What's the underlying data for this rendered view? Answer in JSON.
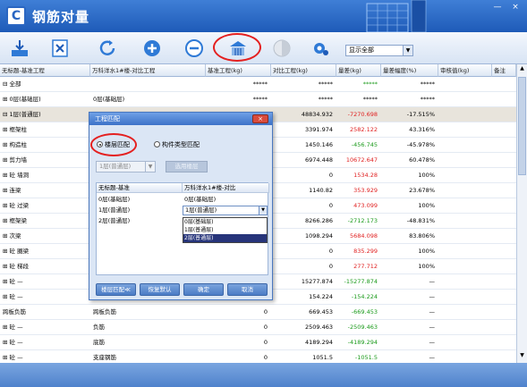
{
  "window": {
    "app_icon": "C",
    "title": "钢筋对量",
    "minimize": "—",
    "close": "×"
  },
  "toolbar": {
    "buttons": [
      "import-icon",
      "export-excel-icon",
      "refresh-icon",
      "expand-icon",
      "collapse-icon",
      "floor-match-icon",
      "compare-icon",
      "settings-icon"
    ],
    "display_select": "显示全部"
  },
  "grid": {
    "headers": [
      "无标题-基准工程",
      "万科洋水1#楼-对比工程",
      "基准工程(kg)",
      "对比工程(kg)",
      "量差(kg)",
      "量差幅度(%)",
      "审核值(kg)",
      "备注"
    ],
    "rows": [
      {
        "name": "⊟ 全部",
        "compare": "",
        "base": "*****",
        "cmp": "*****",
        "diff": "*****",
        "pct": "*****",
        "diff_color": "green"
      },
      {
        "name": "⊞ 0层(基础层)",
        "compare": "0层(基础层)",
        "base": "*****",
        "cmp": "*****",
        "diff": "*****",
        "pct": "*****",
        "diff_color": ""
      },
      {
        "name": "⊟ 1层(普通层)",
        "compare": "",
        "base": "",
        "cmp": "48834.932",
        "diff": "-7270.698",
        "pct": "-17.515%",
        "diff_color": "red"
      },
      {
        "name": "⊞ 框架柱",
        "compare": "",
        "base": "",
        "cmp": "3391.974",
        "diff": "2582.122",
        "pct": "43.316%",
        "diff_color": "red"
      },
      {
        "name": "⊞ 构造柱",
        "compare": "",
        "base": "",
        "cmp": "1450.146",
        "diff": "-456.745",
        "pct": "-45.978%",
        "diff_color": "green"
      },
      {
        "name": "⊞ 剪力墙",
        "compare": "",
        "base": "",
        "cmp": "6974.448",
        "diff": "10672.647",
        "pct": "60.478%",
        "diff_color": "red"
      },
      {
        "name": "⊞ 砼 墙洞",
        "compare": "",
        "base": "",
        "cmp": "0",
        "diff": "1534.28",
        "pct": "100%",
        "diff_color": "red"
      },
      {
        "name": "⊞ 连梁",
        "compare": "",
        "base": "",
        "cmp": "1140.82",
        "diff": "353.929",
        "pct": "23.678%",
        "diff_color": "red"
      },
      {
        "name": "⊞ 砼 过梁",
        "compare": "",
        "base": "",
        "cmp": "0",
        "diff": "473.099",
        "pct": "100%",
        "diff_color": "red"
      },
      {
        "name": "⊞ 框架梁",
        "compare": "",
        "base": "",
        "cmp": "8266.286",
        "diff": "-2712.173",
        "pct": "-48.831%",
        "diff_color": "green"
      },
      {
        "name": "⊞ 次梁",
        "compare": "",
        "base": "",
        "cmp": "1098.294",
        "diff": "5684.098",
        "pct": "83.806%",
        "diff_color": "red"
      },
      {
        "name": "⊞ 砼 圈梁",
        "compare": "",
        "base": "",
        "cmp": "0",
        "diff": "835.299",
        "pct": "100%",
        "diff_color": "red"
      },
      {
        "name": "⊞ 砼 梯段",
        "compare": "",
        "base": "",
        "cmp": "0",
        "diff": "277.712",
        "pct": "100%",
        "diff_color": "red"
      },
      {
        "name": "⊞ 砼 —",
        "compare": "",
        "base": "",
        "cmp": "15277.874",
        "diff": "-15277.874",
        "pct": "—",
        "diff_color": "green"
      },
      {
        "name": "⊞ 砼 —",
        "compare": "",
        "base": "",
        "cmp": "154.224",
        "diff": "-154.224",
        "pct": "—",
        "diff_color": "green"
      },
      {
        "name": "跨板负筋",
        "compare": "跨板负筋",
        "base": "0",
        "cmp": "669.453",
        "diff": "-669.453",
        "pct": "—",
        "diff_color": "green"
      },
      {
        "name": "⊞ 砼 —",
        "compare": "负筋",
        "base": "0",
        "cmp": "2509.463",
        "diff": "-2509.463",
        "pct": "—",
        "diff_color": "green"
      },
      {
        "name": "⊞ 砼 —",
        "compare": "底筋",
        "base": "0",
        "cmp": "4189.294",
        "diff": "-4189.294",
        "pct": "—",
        "diff_color": "green"
      },
      {
        "name": "⊞ 砼 —",
        "compare": "支座钢筋",
        "base": "0",
        "cmp": "1051.5",
        "diff": "-1051.5",
        "pct": "—",
        "diff_color": "green"
      }
    ]
  },
  "dialog": {
    "title": "工程匹配",
    "close": "×",
    "radio_floor": "楼层匹配",
    "radio_type": "构件类型匹配",
    "floor_select": "1层(普通层)",
    "apply_button": "选用楼层",
    "table_headers": [
      "无标题-基准",
      "万科洋水1#楼-对比"
    ],
    "table_rows": [
      {
        "left": "0层(基础层)",
        "right": "0层(基础层)"
      },
      {
        "left": "1层(普通层)",
        "right": "1层(普通层)"
      },
      {
        "left": "2层(普通层)",
        "right": ""
      }
    ],
    "dropdown_options": [
      "0层(基础层)",
      "1层(普通层)",
      "2层(普通层)"
    ],
    "buttons": [
      "楼层匹配≪",
      "恢复默认",
      "确定",
      "取消"
    ]
  }
}
